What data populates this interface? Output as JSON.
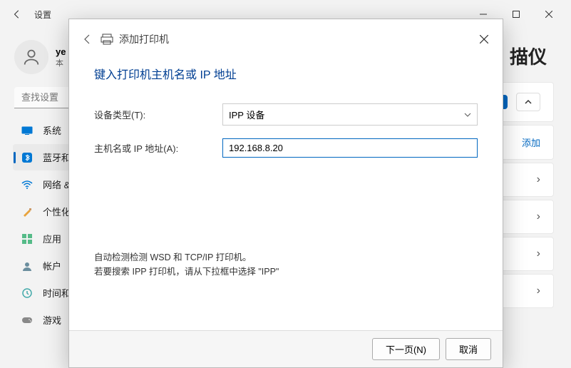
{
  "window": {
    "title": "设置"
  },
  "profile": {
    "name": "ye",
    "sub": "本"
  },
  "search": {
    "placeholder": "查找设置"
  },
  "nav": {
    "system": "系统",
    "bluetooth": "蓝牙和",
    "network": "网络 &",
    "personalization": "个性化",
    "apps": "应用",
    "accounts": "帐户",
    "time": "时间和",
    "gaming": "游戏"
  },
  "content": {
    "heading_fragment": "描仪",
    "add_label": "添加"
  },
  "dialog": {
    "title": "添加打印机",
    "heading": "键入打印机主机名或 IP 地址",
    "device_type_label": "设备类型(T):",
    "device_type_value": "IPP 设备",
    "host_label": "主机名或 IP 地址(A):",
    "host_value": "192.168.8.20",
    "note1": "自动检测检测 WSD 和 TCP/IP 打印机。",
    "note2": "若要搜索 IPP 打印机，请从下拉框中选择 \"IPP\"",
    "next": "下一页(N)",
    "cancel": "取消"
  }
}
